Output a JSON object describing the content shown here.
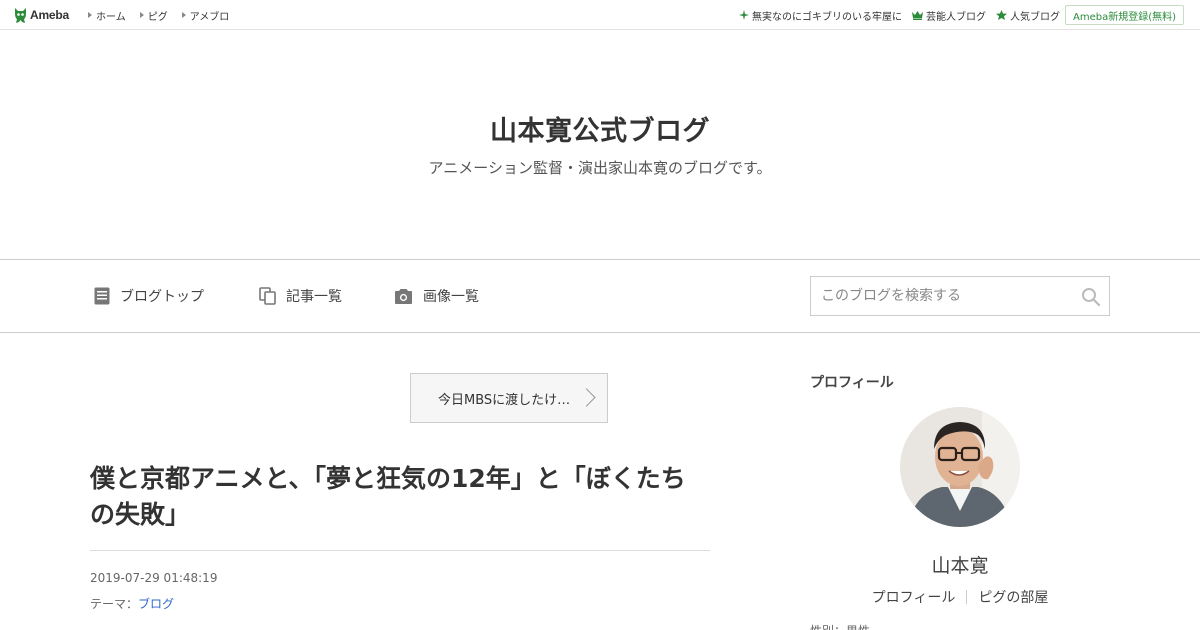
{
  "header": {
    "logo_text": "Ameba",
    "nav": [
      {
        "label": "ホーム"
      },
      {
        "label": "ピグ"
      },
      {
        "label": "アメブロ"
      }
    ],
    "links": [
      {
        "label": "無実なのにゴキブリのいる牢屋に",
        "icon": "sparkle-icon"
      },
      {
        "label": "芸能人ブログ",
        "icon": "crown-icon"
      },
      {
        "label": "人気ブログ",
        "icon": "star-icon"
      }
    ],
    "register_label": "Ameba新規登録(無料)",
    "accent_color": "#2d8c3c"
  },
  "blog": {
    "title": "山本寛公式ブログ",
    "description": "アニメーション監督・演出家山本寛のブログです。"
  },
  "menu": {
    "items": [
      {
        "label": "ブログトップ",
        "icon": "document-icon"
      },
      {
        "label": "記事一覧",
        "icon": "copy-icon"
      },
      {
        "label": "画像一覧",
        "icon": "camera-icon"
      }
    ],
    "search_placeholder": "このブログを検索する"
  },
  "next_entry": {
    "label": "今日MBSに渡したけ…"
  },
  "article": {
    "title": "僕と京都アニメと、「夢と狂気の12年」と「ぼくたちの失敗」",
    "date": "2019-07-29 01:48:19",
    "theme_label": "テーマ：",
    "theme_value": "ブログ"
  },
  "sidebar": {
    "profile_heading": "プロフィール",
    "name": "山本寛",
    "links": [
      {
        "label": "プロフィール"
      },
      {
        "label": "ピグの部屋"
      }
    ],
    "extra": "性別：男性"
  }
}
